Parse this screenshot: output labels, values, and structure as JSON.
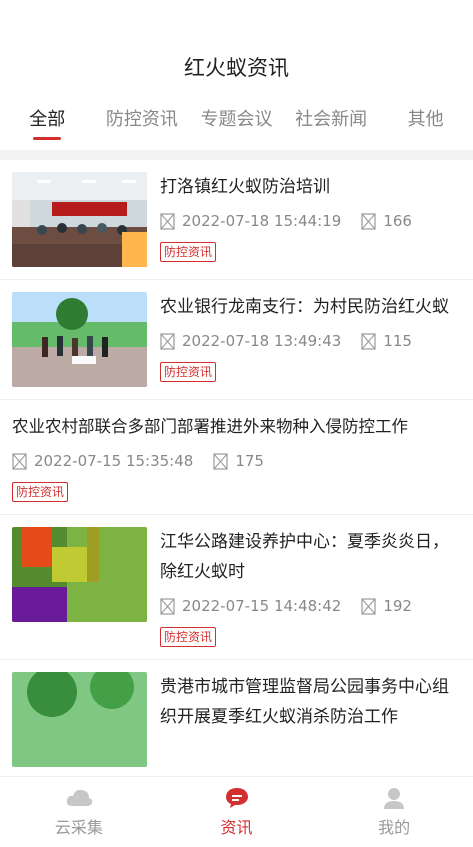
{
  "header": {
    "title": "红火蚁资讯"
  },
  "tabs": [
    {
      "label": "全部"
    },
    {
      "label": "防控资讯"
    },
    {
      "label": "专题会议"
    },
    {
      "label": "社会新闻"
    },
    {
      "label": "其他"
    }
  ],
  "articles": [
    {
      "title": "打洛镇红火蚁防治培训",
      "datetime": "2022-07-18 15:44:19",
      "views": "166",
      "tag": "防控资讯"
    },
    {
      "title": "农业银行龙南支行：为村民防治红火蚁",
      "datetime": "2022-07-18 13:49:43",
      "views": "115",
      "tag": "防控资讯"
    },
    {
      "title": "农业农村部联合多部门部署推进外来物种入侵防控工作",
      "datetime": "2022-07-15 15:35:48",
      "views": "175",
      "tag": "防控资讯"
    },
    {
      "title": "江华公路建设养护中心：夏季炎炎日，除红火蚁时",
      "datetime": "2022-07-15 14:48:42",
      "views": "192",
      "tag": "防控资讯"
    },
    {
      "title": "贵港市城市管理监督局公园事务中心组织开展夏季红火蚁消杀防治工作"
    }
  ],
  "bottom_nav": [
    {
      "label": "云采集",
      "icon": "cloud-icon"
    },
    {
      "label": "资讯",
      "icon": "news-icon"
    },
    {
      "label": "我的",
      "icon": "user-icon"
    }
  ],
  "colors": {
    "accent": "#d32f2f"
  }
}
